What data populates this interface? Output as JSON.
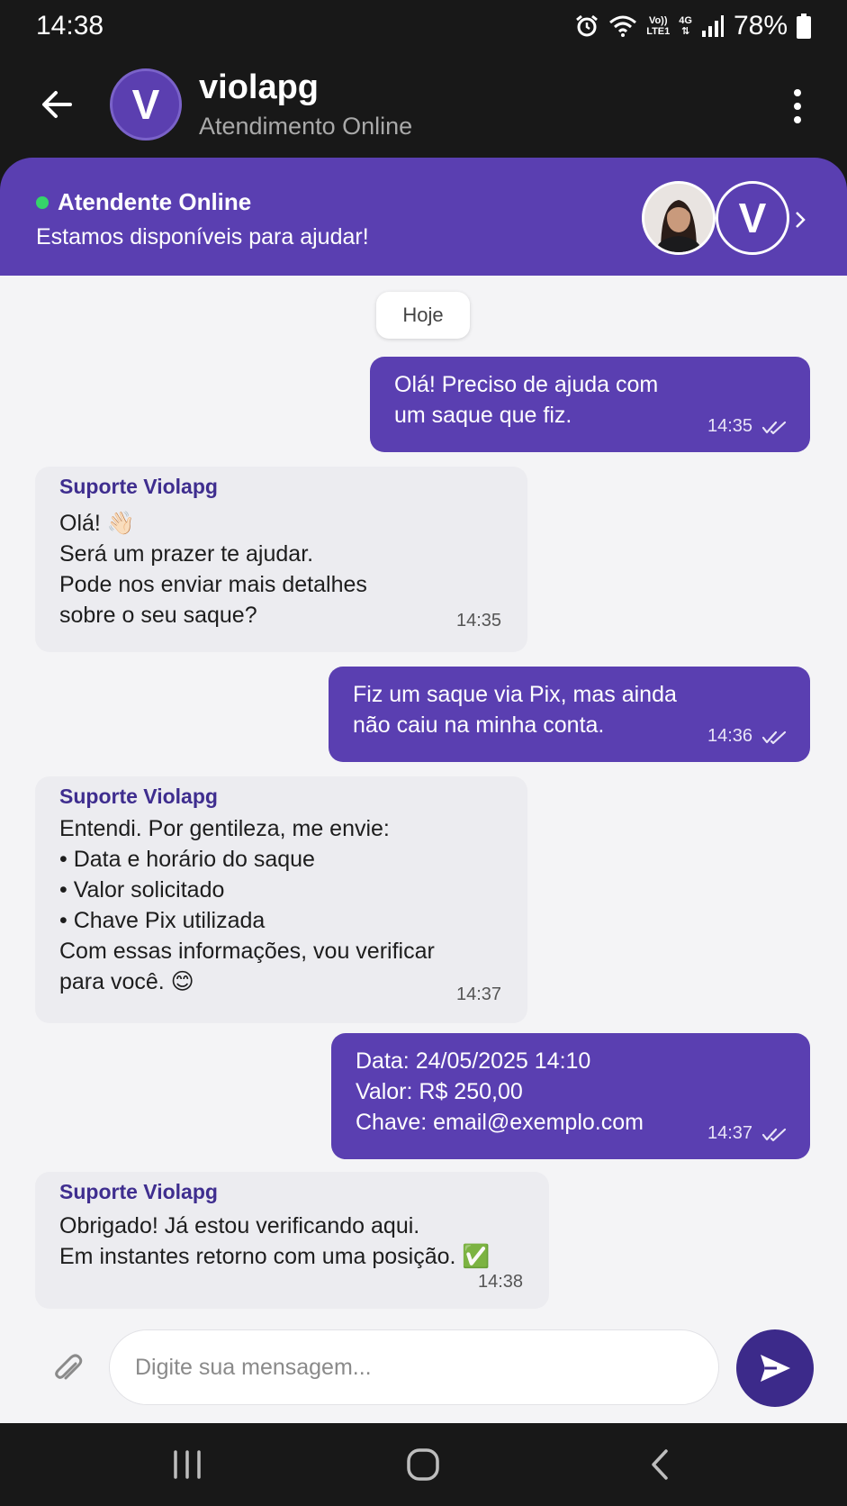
{
  "status_bar": {
    "time": "14:38",
    "volte_top": "Vo))",
    "volte_bottom": "LTE1",
    "net_top": "4G",
    "net_bottom": "⇅",
    "battery": "78%"
  },
  "header": {
    "avatar_letter": "V",
    "title": "violapg",
    "subtitle": "Atendimento Online"
  },
  "banner": {
    "status": "Atendente Online",
    "message": "Estamos disponíveis para ajudar!",
    "brand_letter": "V"
  },
  "chat": {
    "date_label": "Hoje",
    "messages": [
      {
        "direction": "out",
        "text": "Olá! Preciso de ajuda com\num saque que fiz.",
        "time": "14:35"
      },
      {
        "direction": "in",
        "sender": "Suporte Violapg",
        "text": "Olá! 👋🏻\nSerá um prazer te ajudar.\nPode nos enviar mais detalhes\nsobre o seu saque?",
        "time": "14:35"
      },
      {
        "direction": "out",
        "text": "Fiz um saque via Pix, mas ainda\nnão caiu na minha conta.",
        "time": "14:36"
      },
      {
        "direction": "in",
        "sender": "Suporte Violapg",
        "text": "Entendi. Por gentileza, me envie:\n• Data e horário do saque\n• Valor solicitado\n• Chave Pix utilizada\nCom essas informações, vou verificar\npara você. 😊",
        "time": "14:37"
      },
      {
        "direction": "out",
        "text": "Data: 24/05/2025 14:10\nValor: R$ 250,00\nChave: email@exemplo.com",
        "time": "14:37"
      },
      {
        "direction": "in",
        "sender": "Suporte Violapg",
        "text": "Obrigado! Já estou verificando aqui.\nEm instantes retorno com uma posição. ✅",
        "time": "14:38"
      }
    ]
  },
  "composer": {
    "placeholder": "Digite sua mensagem..."
  },
  "colors": {
    "brand": "#5a3fb1",
    "send": "#3c2a8a",
    "online": "#35d46a",
    "sender_name": "#3f2e8f"
  }
}
